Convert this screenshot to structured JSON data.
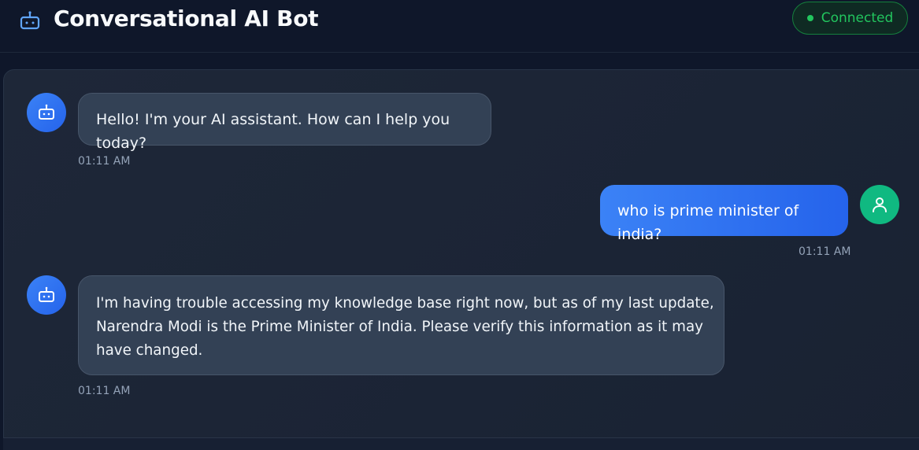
{
  "header": {
    "title": "Conversational AI Bot",
    "icon": "robot-icon",
    "status": {
      "label": "Connected",
      "color": "#22c55e"
    }
  },
  "messages": [
    {
      "role": "bot",
      "avatar_icon": "robot-icon",
      "text": "Hello! I'm your AI assistant. How can I help you today?",
      "time": "01:11 AM"
    },
    {
      "role": "user",
      "avatar_icon": "user-icon",
      "text": "who is prime minister of india?",
      "time": "01:11 AM"
    },
    {
      "role": "bot",
      "avatar_icon": "robot-icon",
      "lines": [
        "I'm having trouble accessing my knowledge base right now, but as of my last update,",
        "Narendra Modi is the Prime Minister of India. Please verify this information as it may",
        "have changed."
      ],
      "time": "01:11 AM"
    }
  ],
  "colors": {
    "background": "#0f172a",
    "bot_bubble": "#334155",
    "user_bubble": "#3b82f6",
    "bot_avatar": "#3b82f6",
    "user_avatar": "#10b981",
    "accent_green": "#22c55e"
  }
}
